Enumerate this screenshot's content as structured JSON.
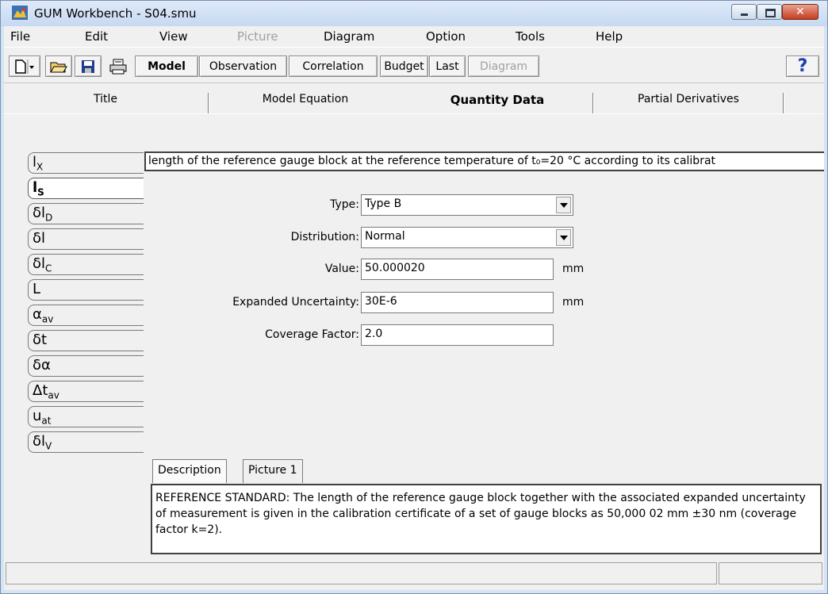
{
  "window": {
    "title": "GUM Workbench - S04.smu"
  },
  "menubar": [
    "File",
    "Edit",
    "View",
    "Picture",
    "Diagram",
    "Option",
    "Tools",
    "Help"
  ],
  "toolbar": {
    "model": "Model",
    "observation": "Observation",
    "correlation": "Correlation",
    "budget": "Budget",
    "last": "Last",
    "diagram": "Diagram",
    "help_glyph": "?"
  },
  "tabs": [
    "Title",
    "Model Equation",
    "Quantity Data",
    "Partial Derivatives"
  ],
  "selected_tab": "Quantity Data",
  "quantities": [
    "l_X",
    "l_S",
    "δl_D",
    "δl",
    "δl_C",
    "L",
    "α_av",
    "δt",
    "δα",
    "Δt_av",
    "u_at",
    "δl_V"
  ],
  "selected_quantity": "l_S",
  "quantity_description": "length of the reference gauge block at the reference temperature of t₀=20 °C according to its calibrat",
  "form": {
    "type_label": "Type:",
    "type_value": "Type B",
    "distribution_label": "Distribution:",
    "distribution_value": "Normal",
    "value_label": "Value:",
    "value": "50.000020",
    "value_unit": "mm",
    "uncertainty_label": "Expanded Uncertainty:",
    "uncertainty": "30E-6",
    "uncertainty_unit": "mm",
    "coverage_label": "Coverage Factor:",
    "coverage": "2.0"
  },
  "subtabs": {
    "description": "Description",
    "picture": "Picture 1"
  },
  "description_text": "REFERENCE STANDARD: The length of the reference gauge block together with the associated expanded uncertainty of measurement is given in the calibration certificate of a set of gauge blocks as 50,000 02 mm ±30 nm (coverage factor k=2)."
}
